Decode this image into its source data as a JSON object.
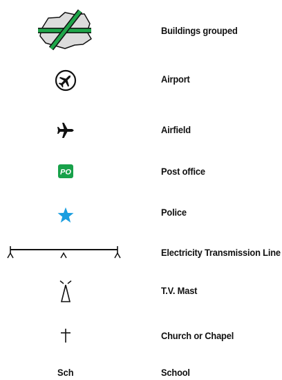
{
  "legend": {
    "items": [
      {
        "label": "Buildings grouped",
        "icon": "buildings-grouped-icon"
      },
      {
        "label": "Airport",
        "icon": "airport-icon"
      },
      {
        "label": "Airfield",
        "icon": "airfield-icon"
      },
      {
        "label": "Post office",
        "icon": "post-office-icon",
        "symbol_text": "PO"
      },
      {
        "label": "Police",
        "icon": "police-star-icon"
      },
      {
        "label": "Electricity Transmission Line",
        "icon": "transmission-line-icon"
      },
      {
        "label": "T.V. Mast",
        "icon": "tv-mast-icon"
      },
      {
        "label": "Church or Chapel",
        "icon": "church-cross-icon"
      },
      {
        "label": "School",
        "icon": "school-symbol",
        "symbol_text": "Sch"
      }
    ]
  },
  "colors": {
    "buildings_fill": "#dcdcdc",
    "buildings_stroke": "#111111",
    "green_bar": "#1fa64a",
    "post_office_green": "#18a14a",
    "police_blue": "#1a9ee0",
    "ink": "#111111"
  }
}
